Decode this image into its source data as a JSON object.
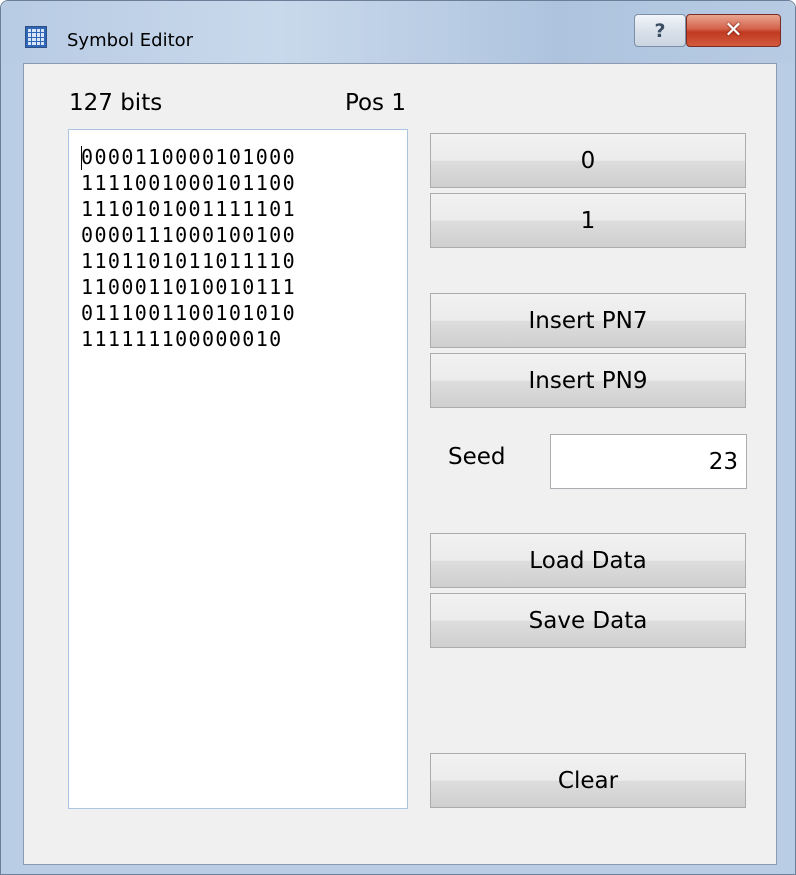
{
  "window": {
    "title": "Symbol Editor",
    "help_glyph": "?",
    "close_glyph": "✕"
  },
  "editor": {
    "bits_label": "127 bits",
    "pos_label": "Pos 1",
    "rows": [
      "0000110000101000",
      "1111001000101100",
      "1110101001111101",
      "0000111000100100",
      "1101101011011110",
      "1100011010010111",
      "0111001100101010",
      "111111100000010"
    ]
  },
  "buttons": {
    "zero": "0",
    "one": "1",
    "insert_pn7": "Insert PN7",
    "insert_pn9": "Insert PN9",
    "load_data": "Load Data",
    "save_data": "Save Data",
    "clear": "Clear"
  },
  "seed": {
    "label": "Seed",
    "value": "23"
  },
  "icons": {
    "app": "grid-icon",
    "help": "help-icon",
    "close": "close-icon"
  }
}
